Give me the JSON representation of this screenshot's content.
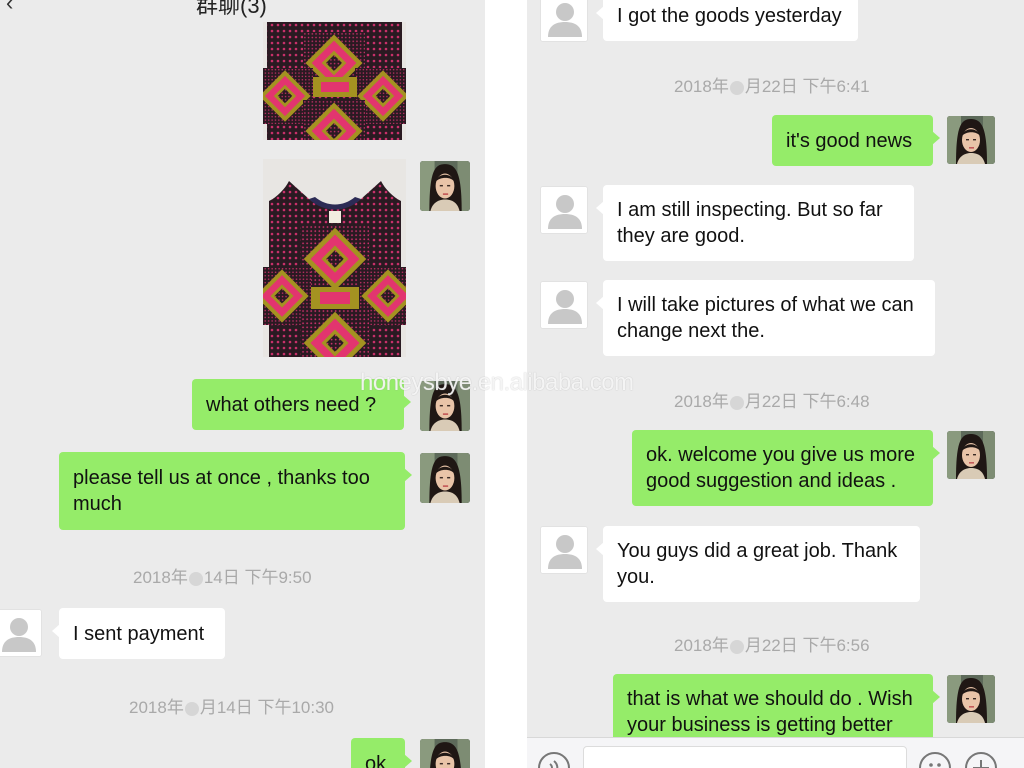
{
  "left": {
    "header_title": "群聊(3)",
    "back_icon": "chevron-left-icon",
    "messages": {
      "what_others": "what others need ?",
      "please_tell": "please tell us at once , thanks too much",
      "sent_payment": "I sent payment",
      "ok": "ok"
    },
    "timestamps": {
      "t1_pre": "2018年",
      "t1_post": "14日  下午9:50",
      "t2_pre": "2018年",
      "t2_post": "月14日  下午10:30"
    }
  },
  "right": {
    "messages": {
      "got_goods": "I got the goods yesterday",
      "good_news": "it's good news",
      "inspecting": "I am still inspecting.   But so far they are good.",
      "pictures": "I will take pictures of what we can change next the.",
      "welcome": "ok. welcome you give us more good suggestion and ideas .",
      "great_job": "You guys did a great job.  Thank you.",
      "that_is": "that is what we should do . Wish your business is getting better"
    },
    "timestamps": {
      "t1_pre": "2018年",
      "t1_post": "月22日  下午6:41",
      "t2_pre": "2018年",
      "t2_post": "月22日  下午6:48",
      "t3_pre": "2018年",
      "t3_post": "月22日  下午6:56"
    },
    "input_bar": {
      "voice_icon": "voice-icon",
      "emoji_icon": "emoji-icon",
      "plus_icon": "plus-icon"
    }
  },
  "watermark": "honeysbye.en.alibaba.com",
  "colors": {
    "sent_bubble": "#95ec69",
    "received_bubble": "#ffffff",
    "chat_background": "#ebebeb",
    "timestamp_text": "#a9a9a9",
    "dress_pink": "#e2356f",
    "dress_olive": "#a49221"
  }
}
